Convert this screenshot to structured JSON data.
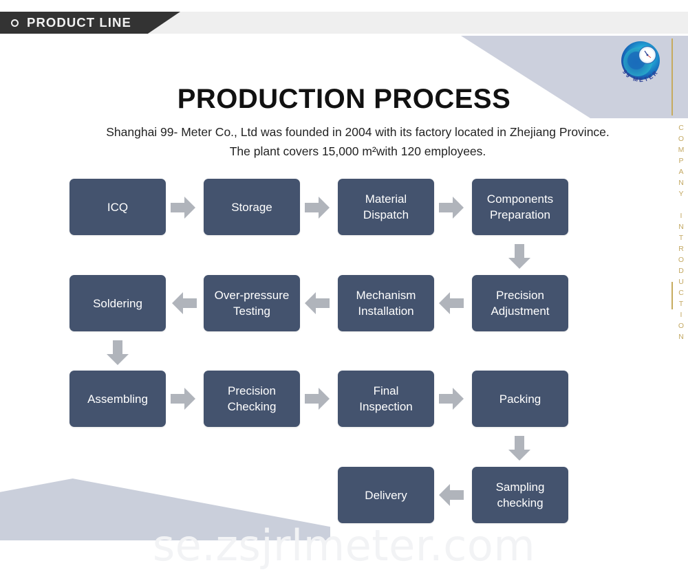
{
  "banner": {
    "label": "PRODUCT LINE",
    "icon": "ring-icon",
    "bg_color": "#333333",
    "text_color": "#f2f2f2"
  },
  "logo": {
    "name": "99-meter-logo",
    "brand_text": "99 METER",
    "colors": [
      "#1f6fb5",
      "#23b8c8",
      "#2a3f8f"
    ]
  },
  "side_rail": {
    "vertical_text": "COMPANY INTRODUCTION",
    "color": "#c3a862"
  },
  "header": {
    "title": "PRODUCTION PROCESS",
    "subtitle": "Shanghai 99- Meter Co., Ltd was founded in 2004 with its factory located in Zhejiang Province. The plant covers 15,000 m²with 120 employees."
  },
  "watermark": {
    "text": "se.zsjrlmeter.com",
    "color": "#f2f3f5"
  },
  "flow": {
    "box_color": "#44536E",
    "box_text_color": "#ffffff",
    "arrow_color": "#b0b4bb",
    "steps": [
      {
        "id": "icq",
        "label": "ICQ",
        "row": 1
      },
      {
        "id": "storage",
        "label": "Storage",
        "row": 1
      },
      {
        "id": "material-dispatch",
        "label": "Material\nDispatch",
        "row": 1
      },
      {
        "id": "components-preparation",
        "label": "Components\nPreparation",
        "row": 1
      },
      {
        "id": "precision-adjustment",
        "label": "Precision\nAdjustment",
        "row": 2
      },
      {
        "id": "mechanism-installation",
        "label": "Mechanism\nInstallation",
        "row": 2
      },
      {
        "id": "over-pressure-testing",
        "label": "Over-pressure\nTesting",
        "row": 2
      },
      {
        "id": "soldering",
        "label": "Soldering",
        "row": 2
      },
      {
        "id": "assembling",
        "label": "Assembling",
        "row": 3
      },
      {
        "id": "precision-checking",
        "label": "Precision\nChecking",
        "row": 3
      },
      {
        "id": "final-inspection",
        "label": "Final\nInspection",
        "row": 3
      },
      {
        "id": "packing",
        "label": "Packing",
        "row": 3
      },
      {
        "id": "sampling-checking",
        "label": "Sampling\nchecking",
        "row": 4
      },
      {
        "id": "delivery",
        "label": "Delivery",
        "row": 4
      }
    ],
    "labels": {
      "icq": "ICQ",
      "storage": "Storage",
      "material_dispatch_l1": "Material",
      "material_dispatch_l2": "Dispatch",
      "components_l1": "Components",
      "components_l2": "Preparation",
      "precision_adjustment_l1": "Precision",
      "precision_adjustment_l2": "Adjustment",
      "mechanism_l1": "Mechanism",
      "mechanism_l2": "Installation",
      "overpressure_l1": "Over-pressure",
      "overpressure_l2": "Testing",
      "soldering": "Soldering",
      "assembling": "Assembling",
      "precision_checking_l1": "Precision",
      "precision_checking_l2": "Checking",
      "final_inspection_l1": "Final",
      "final_inspection_l2": "Inspection",
      "packing": "Packing",
      "sampling_l1": "Sampling",
      "sampling_l2": "checking",
      "delivery": "Delivery"
    },
    "connectors": [
      {
        "from": "icq",
        "to": "storage",
        "dir": "right"
      },
      {
        "from": "storage",
        "to": "material-dispatch",
        "dir": "right"
      },
      {
        "from": "material-dispatch",
        "to": "components-preparation",
        "dir": "right"
      },
      {
        "from": "components-preparation",
        "to": "precision-adjustment",
        "dir": "down"
      },
      {
        "from": "precision-adjustment",
        "to": "mechanism-installation",
        "dir": "left"
      },
      {
        "from": "mechanism-installation",
        "to": "over-pressure-testing",
        "dir": "left"
      },
      {
        "from": "over-pressure-testing",
        "to": "soldering",
        "dir": "left"
      },
      {
        "from": "soldering",
        "to": "assembling",
        "dir": "down"
      },
      {
        "from": "assembling",
        "to": "precision-checking",
        "dir": "right"
      },
      {
        "from": "precision-checking",
        "to": "final-inspection",
        "dir": "right"
      },
      {
        "from": "final-inspection",
        "to": "packing",
        "dir": "right"
      },
      {
        "from": "packing",
        "to": "sampling-checking",
        "dir": "down"
      },
      {
        "from": "sampling-checking",
        "to": "delivery",
        "dir": "left"
      }
    ]
  }
}
